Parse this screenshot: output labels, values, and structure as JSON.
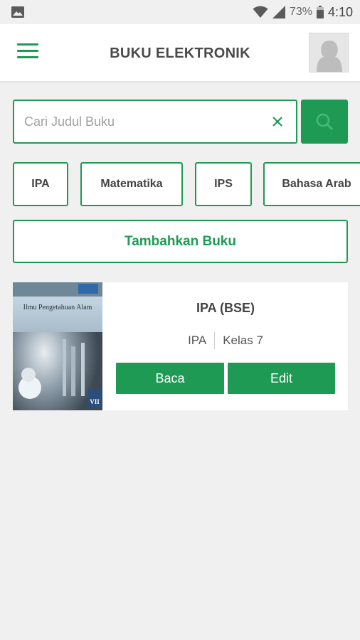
{
  "status_bar": {
    "battery_percent": "73%",
    "time": "4:10",
    "icons": [
      "image-icon",
      "wifi-icon",
      "signal-icon",
      "battery-icon"
    ]
  },
  "app_bar": {
    "title": "BUKU ELEKTRONIK",
    "menu_icon": "hamburger-menu-icon",
    "avatar_icon": "user-avatar-icon"
  },
  "search": {
    "placeholder": "Cari Judul Buku",
    "value": "",
    "clear_icon": "close-icon",
    "button_icon": "search-icon"
  },
  "categories": [
    "IPA",
    "Matematika",
    "IPS",
    "Bahasa Arab"
  ],
  "add_book_label": "Tambahkan Buku",
  "books": [
    {
      "title": "IPA (BSE)",
      "subject": "IPA",
      "grade": "Kelas 7",
      "cover_title": "Ilmu Pengetahuan Alam",
      "cover_grade": "VII",
      "read_label": "Baca",
      "edit_label": "Edit"
    }
  ],
  "colors": {
    "accent": "#1f9a55",
    "background": "#f0f0f0",
    "card": "#ffffff",
    "title_text": "#4a4a4a"
  }
}
